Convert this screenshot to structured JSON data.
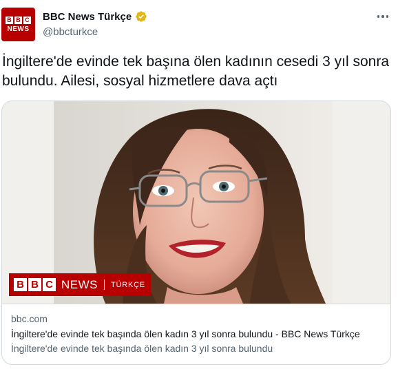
{
  "author": {
    "avatar_blocks": [
      "B",
      "B",
      "C"
    ],
    "avatar_text": "NEWS",
    "display_name": "BBC News Türkçe",
    "handle": "@bbcturkce",
    "verified_color": "#e2b719"
  },
  "tweet": {
    "text": "İngiltere'de evinde tek başına ölen kadının cesedi 3 yıl sonra bulundu. Ailesi, sosyal hizmetlere dava açtı"
  },
  "card": {
    "banner": {
      "blocks": [
        "B",
        "B",
        "C"
      ],
      "news": "NEWS",
      "turkce": "TÜRKÇE"
    },
    "domain": "bbc.com",
    "title": "İngiltere'de evinde tek başında ölen kadın 3 yıl sonra bulundu - BBC News Türkçe",
    "description": "İngiltere'de evinde tek başında ölen kadın 3 yıl sonra bulundu"
  },
  "colors": {
    "brand_red": "#b80000",
    "text_primary": "#0f1419",
    "text_secondary": "#536471",
    "border": "#cfd9de"
  },
  "icons": [
    "verified-badge-icon",
    "more-options-icon"
  ]
}
